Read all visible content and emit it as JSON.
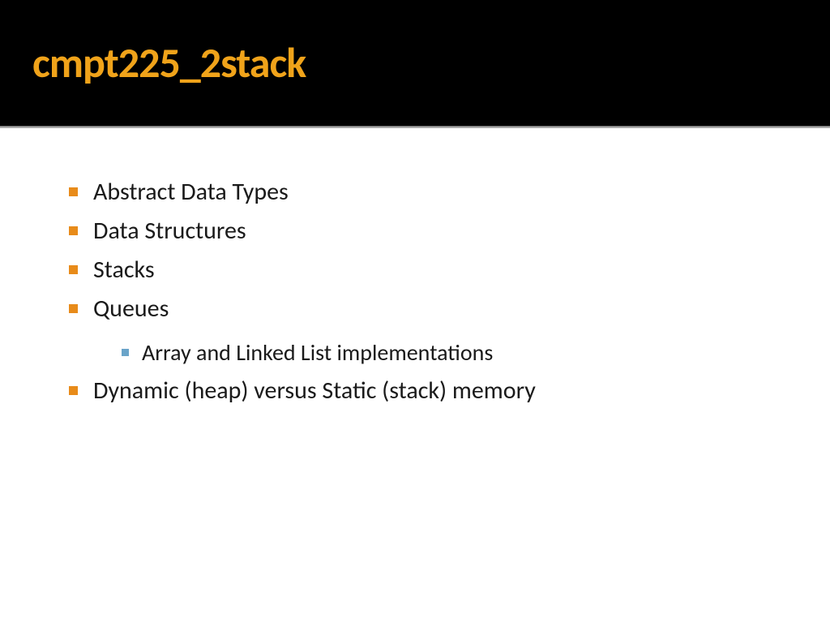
{
  "title": "cmpt225_2stack",
  "bullets": [
    {
      "text": "Abstract Data Types",
      "sub": []
    },
    {
      "text": "Data Structures",
      "sub": []
    },
    {
      "text": "Stacks",
      "sub": []
    },
    {
      "text": "Queues",
      "sub": [
        "Array and Linked List implementations"
      ]
    },
    {
      "text": "Dynamic (heap) versus Static (stack) memory",
      "sub": []
    }
  ]
}
